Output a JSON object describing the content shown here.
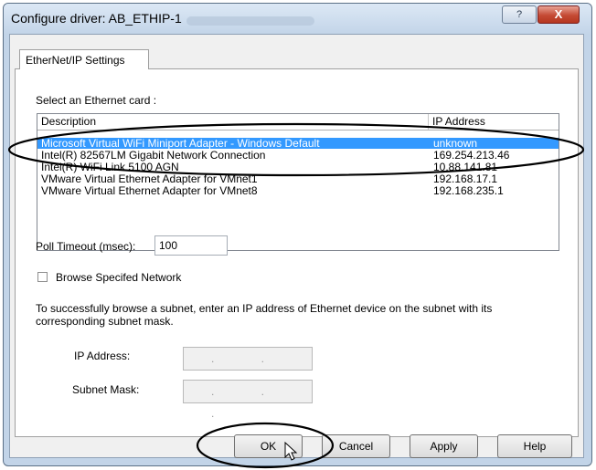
{
  "window": {
    "title": "Configure driver: AB_ETHIP-1",
    "help_glyph": "?",
    "close_glyph": "X"
  },
  "tab": {
    "label": "EtherNet/IP Settings"
  },
  "card_section": {
    "label": "Select an Ethernet card :",
    "columns": [
      "Description",
      "IP Address"
    ],
    "rows": [
      {
        "description": "Microsoft Virtual WiFi Miniport Adapter - Windows Default",
        "ip": "unknown",
        "selected": true
      },
      {
        "description": "Intel(R) 82567LM Gigabit Network Connection",
        "ip": "169.254.213.46",
        "selected": false
      },
      {
        "description": "Intel(R) WiFi Link 5100 AGN",
        "ip": "10.88.141.81",
        "selected": false
      },
      {
        "description": "VMware Virtual Ethernet Adapter for VMnet1",
        "ip": "192.168.17.1",
        "selected": false
      },
      {
        "description": "VMware Virtual Ethernet Adapter for VMnet8",
        "ip": "192.168.235.1",
        "selected": false
      }
    ]
  },
  "poll_timeout": {
    "label": "Poll Timeout (msec):",
    "value": "100"
  },
  "browse": {
    "label": "Browse Specifed Network",
    "checked": false
  },
  "subnet_info": {
    "line1": "To successfully browse a subnet, enter an IP address of Ethernet device on the subnet with its",
    "line2": "corresponding subnet mask."
  },
  "ip_address": {
    "label": "IP Address:",
    "value": ". . ."
  },
  "subnet_mask": {
    "label": "Subnet Mask:",
    "value": ". . ."
  },
  "buttons": {
    "ok": "OK",
    "cancel": "Cancel",
    "apply": "Apply",
    "help": "Help"
  },
  "colors": {
    "selection": "#3399ff",
    "annotation": "#000000",
    "close": "#c44a34"
  }
}
